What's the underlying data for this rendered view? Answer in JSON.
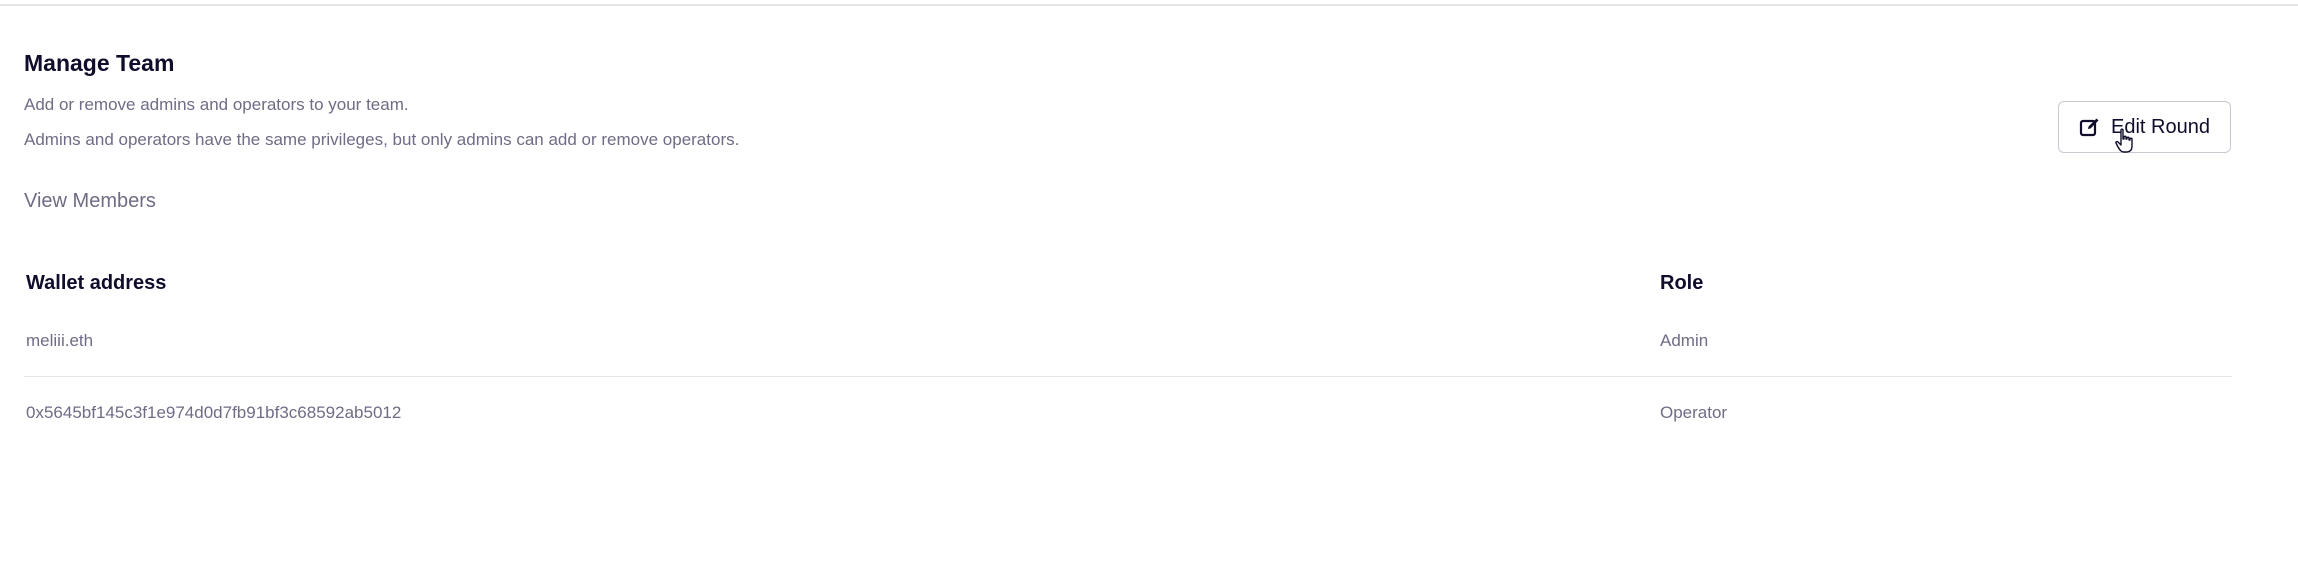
{
  "section": {
    "title": "Manage Team",
    "description_line_1": "Add or remove admins and operators to your team.",
    "description_line_2": "Admins and operators have the same privileges, but only admins can add or remove operators.",
    "view_members_label": "View Members"
  },
  "actions": {
    "edit_round_label": "Edit Round",
    "edit_icon": "edit-square-icon"
  },
  "members_table": {
    "columns": [
      "Wallet address",
      "Role"
    ],
    "rows": [
      {
        "wallet": "meliii.eth",
        "role": "Admin"
      },
      {
        "wallet": "0x5645bf145c3f1e974d0d7fb91bf3c68592ab5012",
        "role": "Operator"
      }
    ]
  },
  "colors": {
    "heading": "#0f0d2b",
    "muted_text": "#6f6c85",
    "border": "#c9c8d1",
    "divider": "#e6e6ea",
    "background": "#ffffff"
  }
}
